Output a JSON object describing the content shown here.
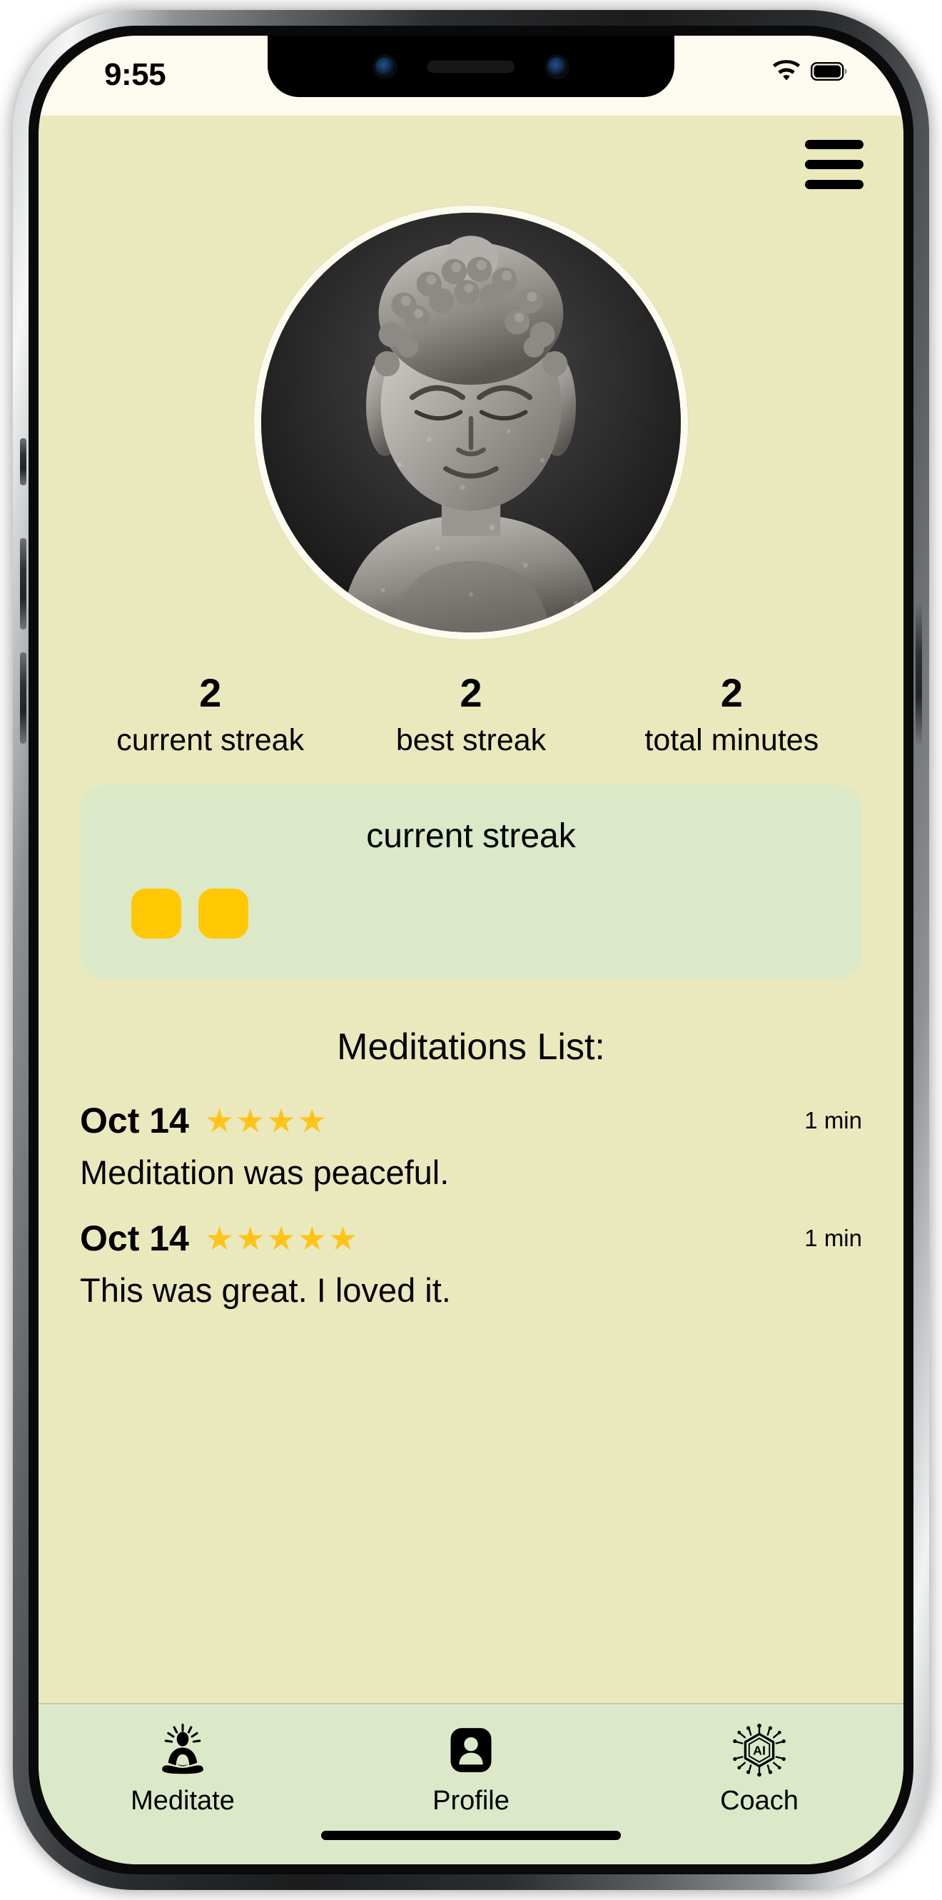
{
  "status_bar": {
    "time": "9:55",
    "wifi_icon": "wifi-icon",
    "battery_icon": "battery-icon"
  },
  "header": {
    "menu_icon": "hamburger-menu-icon"
  },
  "profile": {
    "avatar_alt": "buddha-statue-avatar"
  },
  "stats": [
    {
      "value": "2",
      "label": "current streak"
    },
    {
      "value": "2",
      "label": "best streak"
    },
    {
      "value": "2",
      "label": "total minutes"
    }
  ],
  "streak_card": {
    "title": "current streak",
    "filled_days": 2,
    "dot_color": "#FFC803",
    "card_color": "#dbe9c9"
  },
  "meditations": {
    "section_title": "Meditations List:",
    "items": [
      {
        "date": "Oct 14",
        "rating": 4,
        "stars": "★★★★",
        "duration": "1 min",
        "note": "Meditation was peaceful."
      },
      {
        "date": "Oct 14",
        "rating": 5,
        "stars": "★★★★★",
        "duration": "1 min",
        "note": "This was great. I loved it."
      }
    ]
  },
  "tab_bar": {
    "items": [
      {
        "label": "Meditate",
        "icon": "meditating-person-icon",
        "active": false
      },
      {
        "label": "Profile",
        "icon": "person-card-icon",
        "active": true
      },
      {
        "label": "Coach",
        "icon": "ai-chip-icon",
        "active": false
      }
    ]
  },
  "colors": {
    "app_background": "#eae9bd",
    "card_background": "#dbe9c9",
    "status_bar_background": "#fdfaef",
    "accent_yellow": "#FFC803",
    "star_yellow": "#FFC31A",
    "text": "#000000"
  }
}
